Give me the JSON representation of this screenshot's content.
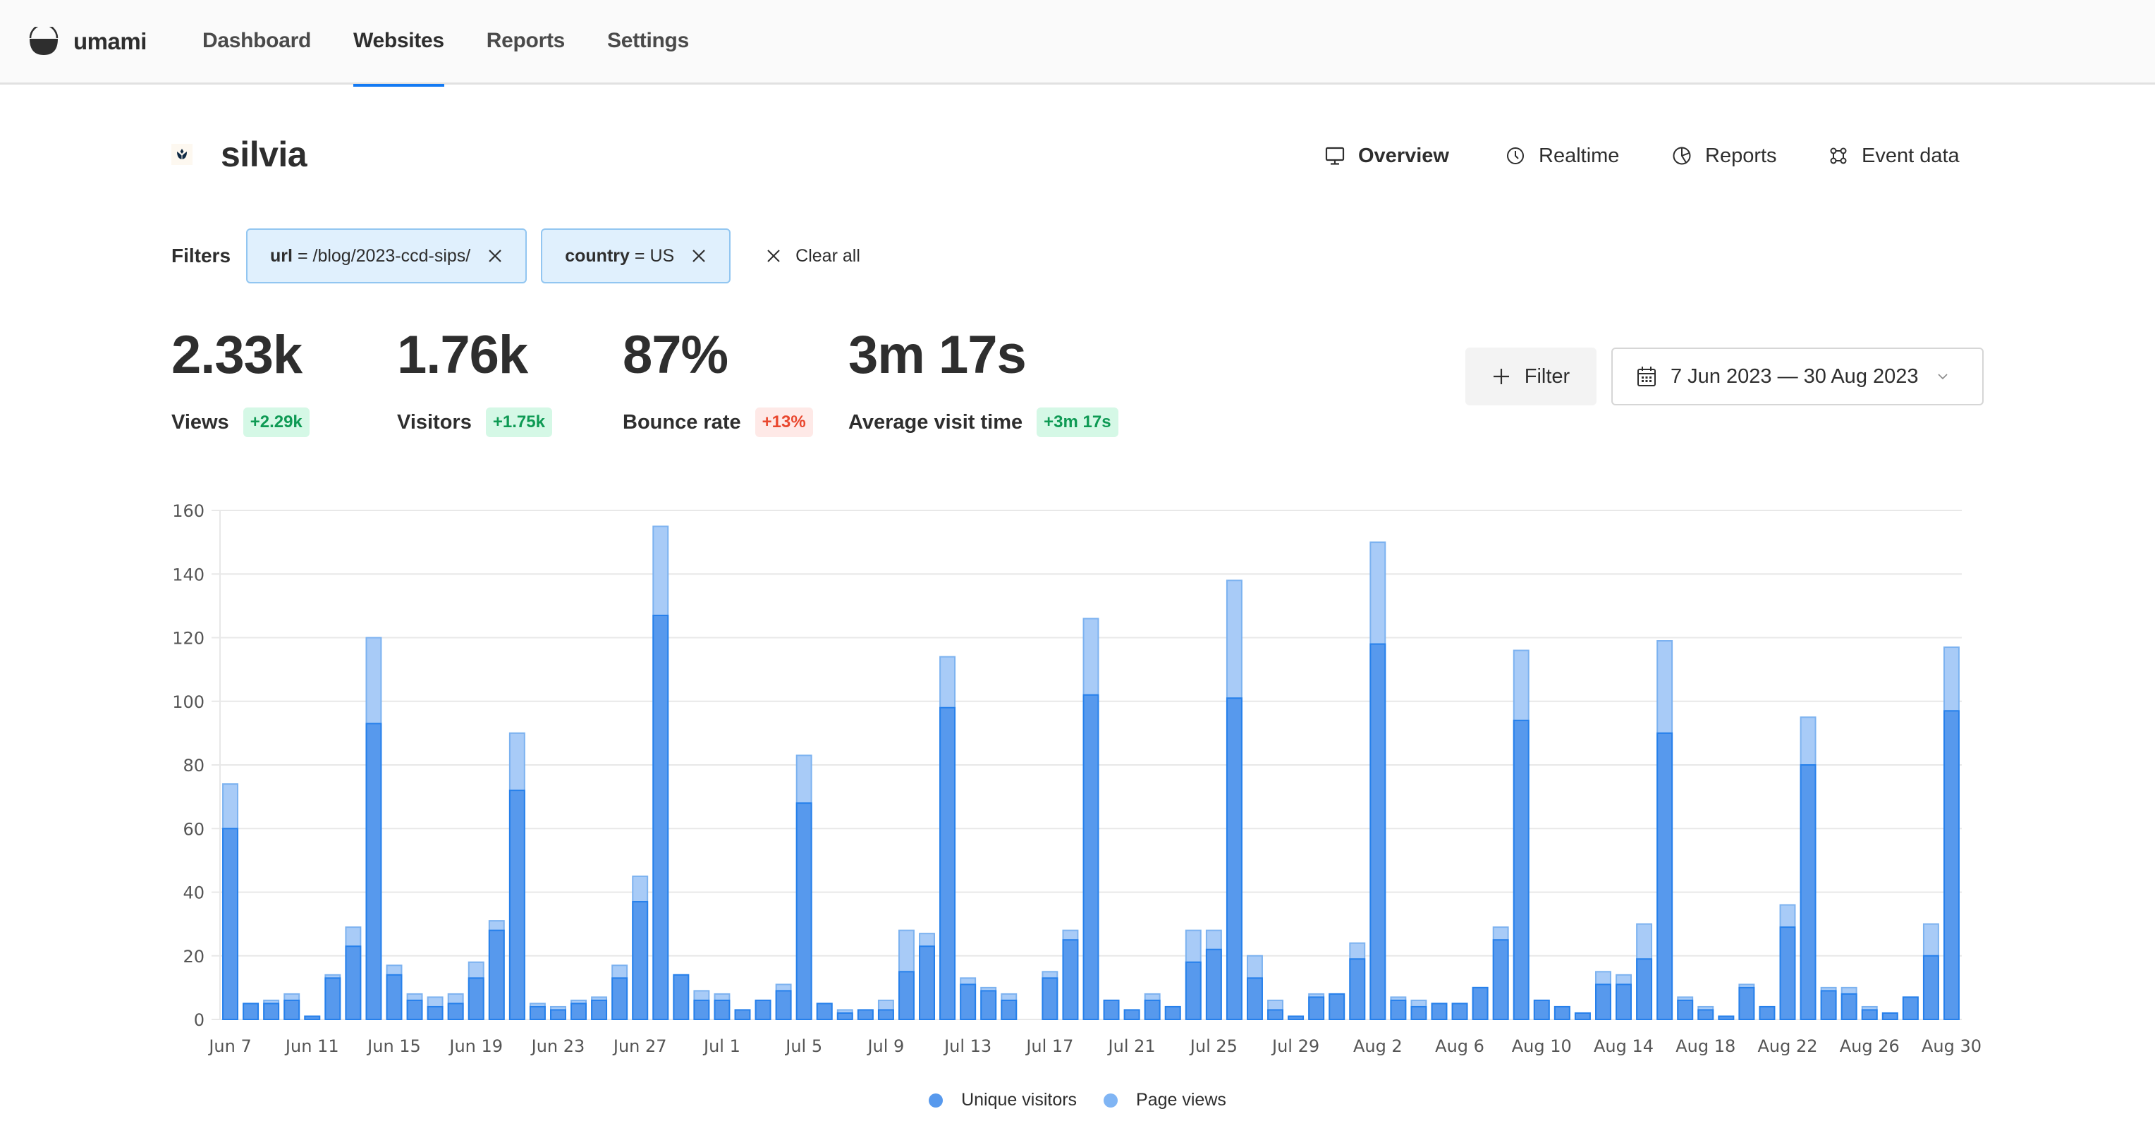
{
  "app": {
    "name": "umami",
    "nav": [
      {
        "label": "Dashboard",
        "active": false
      },
      {
        "label": "Websites",
        "active": true
      },
      {
        "label": "Reports",
        "active": false
      },
      {
        "label": "Settings",
        "active": false
      }
    ],
    "header_icons": [
      "sun-icon",
      "globe-icon",
      "user-circle-icon",
      "chevron-down-icon"
    ],
    "accent_color": "#147af3"
  },
  "website": {
    "name": "silvia",
    "icon": "tulip-icon"
  },
  "tabs": [
    {
      "label": "Overview",
      "icon": "monitor-icon",
      "active": true
    },
    {
      "label": "Realtime",
      "icon": "clock-icon",
      "active": false
    },
    {
      "label": "Reports",
      "icon": "pie-chart-icon",
      "active": false
    },
    {
      "label": "Event data",
      "icon": "nodes-icon",
      "active": false
    }
  ],
  "filters": {
    "label": "Filters",
    "items": [
      {
        "key": "url",
        "operator": "=",
        "value": "/blog/2023-ccd-sips/"
      },
      {
        "key": "country",
        "operator": "=",
        "value": "US"
      }
    ],
    "clear_all_label": "Clear all"
  },
  "metrics": [
    {
      "label": "Views",
      "value": "2.33k",
      "change": "+2.29k",
      "change_type": "positive"
    },
    {
      "label": "Visitors",
      "value": "1.76k",
      "change": "+1.75k",
      "change_type": "positive"
    },
    {
      "label": "Bounce rate",
      "value": "87%",
      "change": "+13%",
      "change_type": "negative"
    },
    {
      "label": "Average visit time",
      "value": "3m 17s",
      "change": "+3m 17s",
      "change_type": "positive"
    }
  ],
  "controls": {
    "filter_button_label": "Filter",
    "date_range_label": "7 Jun 2023 — 30 Aug 2023"
  },
  "chart_data": {
    "type": "bar",
    "stacked": "overlay",
    "title": "",
    "xlabel": "",
    "ylabel": "",
    "ylim": [
      0,
      160
    ],
    "yticks": [
      0,
      20,
      40,
      60,
      80,
      100,
      120,
      140,
      160
    ],
    "grid": true,
    "legend_position": "bottom-center",
    "x_tick_labels": [
      "Jun 7",
      "Jun 11",
      "Jun 15",
      "Jun 19",
      "Jun 23",
      "Jun 27",
      "Jul 1",
      "Jul 5",
      "Jul 9",
      "Jul 13",
      "Jul 17",
      "Jul 21",
      "Jul 25",
      "Jul 29",
      "Aug 2",
      "Aug 6",
      "Aug 10",
      "Aug 14",
      "Aug 18",
      "Aug 22",
      "Aug 26",
      "Aug 30"
    ],
    "x_tick_every": 4,
    "categories": [
      "Jun 7",
      "Jun 8",
      "Jun 9",
      "Jun 10",
      "Jun 11",
      "Jun 12",
      "Jun 13",
      "Jun 14",
      "Jun 15",
      "Jun 16",
      "Jun 17",
      "Jun 18",
      "Jun 19",
      "Jun 20",
      "Jun 21",
      "Jun 22",
      "Jun 23",
      "Jun 24",
      "Jun 25",
      "Jun 26",
      "Jun 27",
      "Jun 28",
      "Jun 29",
      "Jun 30",
      "Jul 1",
      "Jul 2",
      "Jul 3",
      "Jul 4",
      "Jul 5",
      "Jul 6",
      "Jul 7",
      "Jul 8",
      "Jul 9",
      "Jul 10",
      "Jul 11",
      "Jul 12",
      "Jul 13",
      "Jul 14",
      "Jul 15",
      "Jul 16",
      "Jul 17",
      "Jul 18",
      "Jul 19",
      "Jul 20",
      "Jul 21",
      "Jul 22",
      "Jul 23",
      "Jul 24",
      "Jul 25",
      "Jul 26",
      "Jul 27",
      "Jul 28",
      "Jul 29",
      "Jul 30",
      "Jul 31",
      "Aug 1",
      "Aug 2",
      "Aug 3",
      "Aug 4",
      "Aug 5",
      "Aug 6",
      "Aug 7",
      "Aug 8",
      "Aug 9",
      "Aug 10",
      "Aug 11",
      "Aug 12",
      "Aug 13",
      "Aug 14",
      "Aug 15",
      "Aug 16",
      "Aug 17",
      "Aug 18",
      "Aug 19",
      "Aug 20",
      "Aug 21",
      "Aug 22",
      "Aug 23",
      "Aug 24",
      "Aug 25",
      "Aug 26",
      "Aug 27",
      "Aug 28",
      "Aug 29",
      "Aug 30"
    ],
    "series": [
      {
        "name": "Unique visitors",
        "color": "#5799ed",
        "border_color": "#2680eb",
        "values": [
          60,
          5,
          5,
          6,
          1,
          13,
          23,
          93,
          14,
          6,
          4,
          5,
          13,
          28,
          72,
          4,
          3,
          5,
          6,
          13,
          37,
          127,
          14,
          6,
          6,
          3,
          6,
          9,
          68,
          5,
          2,
          3,
          3,
          15,
          23,
          98,
          11,
          9,
          6,
          0,
          13,
          25,
          102,
          6,
          3,
          6,
          4,
          18,
          22,
          101,
          13,
          3,
          1,
          7,
          8,
          19,
          118,
          6,
          4,
          5,
          5,
          10,
          25,
          94,
          6,
          4,
          2,
          11,
          11,
          19,
          90,
          6,
          3,
          1,
          10,
          4,
          29,
          80,
          9,
          8,
          3,
          2,
          7,
          20,
          97
        ]
      },
      {
        "name": "Page views",
        "color": "#a8cbf7",
        "border_color": "#7cb2f0",
        "values": [
          74,
          5,
          6,
          8,
          1,
          14,
          29,
          120,
          17,
          8,
          7,
          8,
          18,
          31,
          90,
          5,
          4,
          6,
          7,
          17,
          45,
          155,
          14,
          9,
          8,
          3,
          6,
          11,
          83,
          5,
          3,
          3,
          6,
          28,
          27,
          114,
          13,
          10,
          8,
          0,
          15,
          28,
          126,
          6,
          3,
          8,
          4,
          28,
          28,
          138,
          20,
          6,
          1,
          8,
          8,
          24,
          150,
          7,
          6,
          5,
          5,
          10,
          29,
          116,
          6,
          4,
          2,
          15,
          14,
          30,
          119,
          7,
          4,
          1,
          11,
          4,
          36,
          95,
          10,
          10,
          4,
          2,
          7,
          30,
          117
        ]
      }
    ]
  }
}
